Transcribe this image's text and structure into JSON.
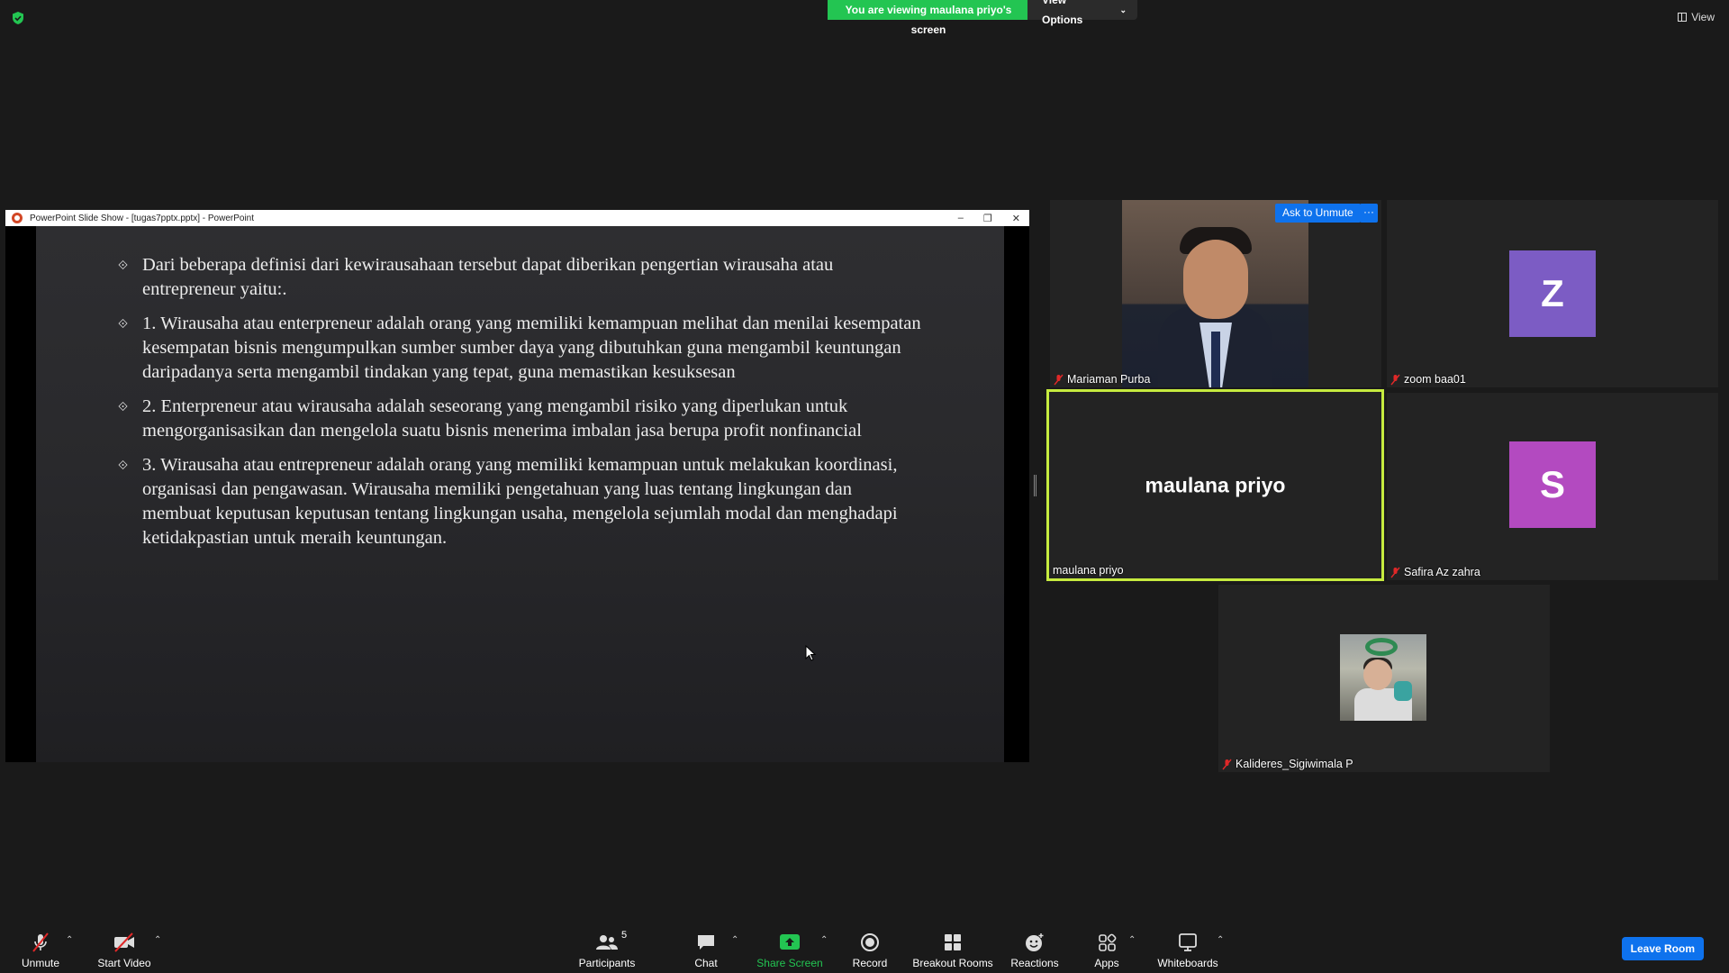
{
  "top": {
    "viewing_text": "You are viewing maulana priyo's screen",
    "view_options": "View Options",
    "view": "View",
    "colors": {
      "banner": "#23c552",
      "accent": "#0e72ed",
      "active_speaker": "#c6eb3f"
    }
  },
  "shared_window": {
    "title": "PowerPoint Slide Show - [tugas7pptx.pptx] - PowerPoint",
    "bullets": [
      "Dari beberapa definisi dari kewirausahaan tersebut dapat diberikan pengertian wirausaha atau entrepreneur yaitu:.",
      " 1. Wirausaha atau enterpreneur adalah orang yang memiliki kemampuan melihat dan menilai kesempatan kesempatan bisnis mengumpulkan sumber sumber daya yang dibutuhkan guna mengambil keuntungan daripadanya serta mengambil tindakan yang tepat, guna memastikan kesuksesan",
      "2. Enterpreneur atau wirausaha adalah seseorang yang mengambil risiko yang diperlukan untuk mengorganisasikan dan mengelola suatu bisnis menerima imbalan jasa berupa profit nonfinancial",
      "3. Wirausaha atau entrepreneur adalah orang yang memiliki kemampuan untuk melakukan koordinasi, organisasi dan pengawasan. Wirausaha memiliki pengetahuan yang luas tentang lingkungan dan membuat keputusan keputusan tentang lingkungan usaha, mengelola sejumlah modal dan menghadapi ketidakpastian untuk meraih keuntungan."
    ]
  },
  "participants": {
    "mariaman": {
      "name": "Mariaman Purba",
      "ask_unmute": "Ask to Unmute",
      "more": "···"
    },
    "zoom": {
      "name": "zoom baa01",
      "initial": "Z",
      "color": "#7c5cc4"
    },
    "maulana": {
      "name": "maulana priyo",
      "big_name": "maulana priyo"
    },
    "safira": {
      "name": "Safira Az zahra",
      "initial": "S",
      "color": "#b34ac0"
    },
    "kalideres": {
      "name": "Kalideres_Sigiwimala P"
    }
  },
  "toolbar": {
    "unmute": "Unmute",
    "start_video": "Start Video",
    "participants": "Participants",
    "participants_count": "5",
    "chat": "Chat",
    "share_screen": "Share Screen",
    "record": "Record",
    "breakout_rooms": "Breakout Rooms",
    "reactions": "Reactions",
    "apps": "Apps",
    "whiteboards": "Whiteboards",
    "leave_room": "Leave Room"
  }
}
